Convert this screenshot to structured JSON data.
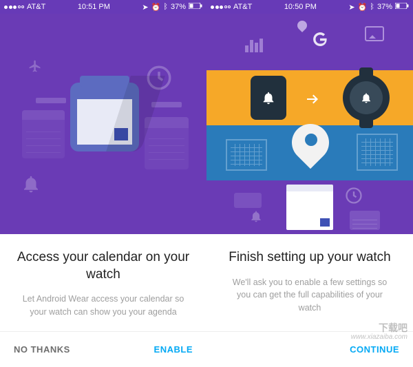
{
  "left": {
    "status": {
      "carrier": "AT&T",
      "time": "10:51 PM",
      "battery": "37%"
    },
    "title": "Access your calendar on your watch",
    "subtitle": "Let Android Wear access your calendar so your watch can show you your agenda",
    "no_thanks": "NO THANKS",
    "enable": "ENABLE"
  },
  "right": {
    "status": {
      "carrier": "AT&T",
      "time": "10:50 PM",
      "battery": "37%"
    },
    "title": "Finish setting up your watch",
    "subtitle": "We'll ask you to enable a few settings so you can get the full capabilities of your watch",
    "continue": "CONTINUE"
  },
  "watermark": {
    "brand": "下载吧",
    "url": "www.xiazaiba.com"
  }
}
